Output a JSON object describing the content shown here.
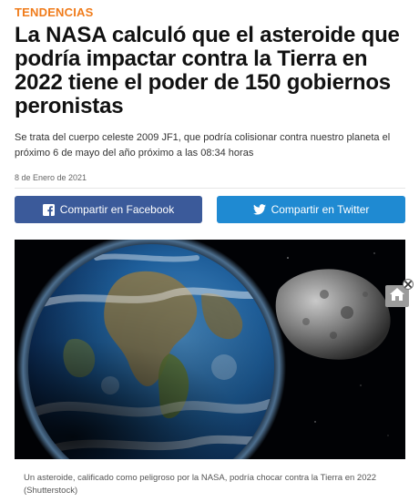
{
  "article": {
    "category": "TENDENCIAS",
    "headline": "La NASA calculó que el asteroide que podría impactar contra la Tierra en 2022 tiene el poder de 150 gobiernos peronistas",
    "lead": "Se trata del cuerpo celeste 2009 JF1, que podría colisionar contra nuestro planeta el próximo 6 de mayo del año próximo a las 08:34 horas",
    "date": "8 de Enero de 2021"
  },
  "share": {
    "facebook_label": "Compartir en Facebook",
    "twitter_label": "Compartir en Twitter",
    "facebook_icon": "facebook-icon",
    "twitter_icon": "twitter-icon"
  },
  "figure": {
    "caption": "Un asteroide, calificado como peligroso por la NASA, podría chocar contra la Tierra en 2022 (Shutterstock)"
  },
  "overlay": {
    "home_icon": "home-icon",
    "close_icon": "close-icon"
  },
  "colors": {
    "category": "#f07c1b",
    "facebook": "#3b5a9a",
    "twitter": "#1f8ad2"
  }
}
